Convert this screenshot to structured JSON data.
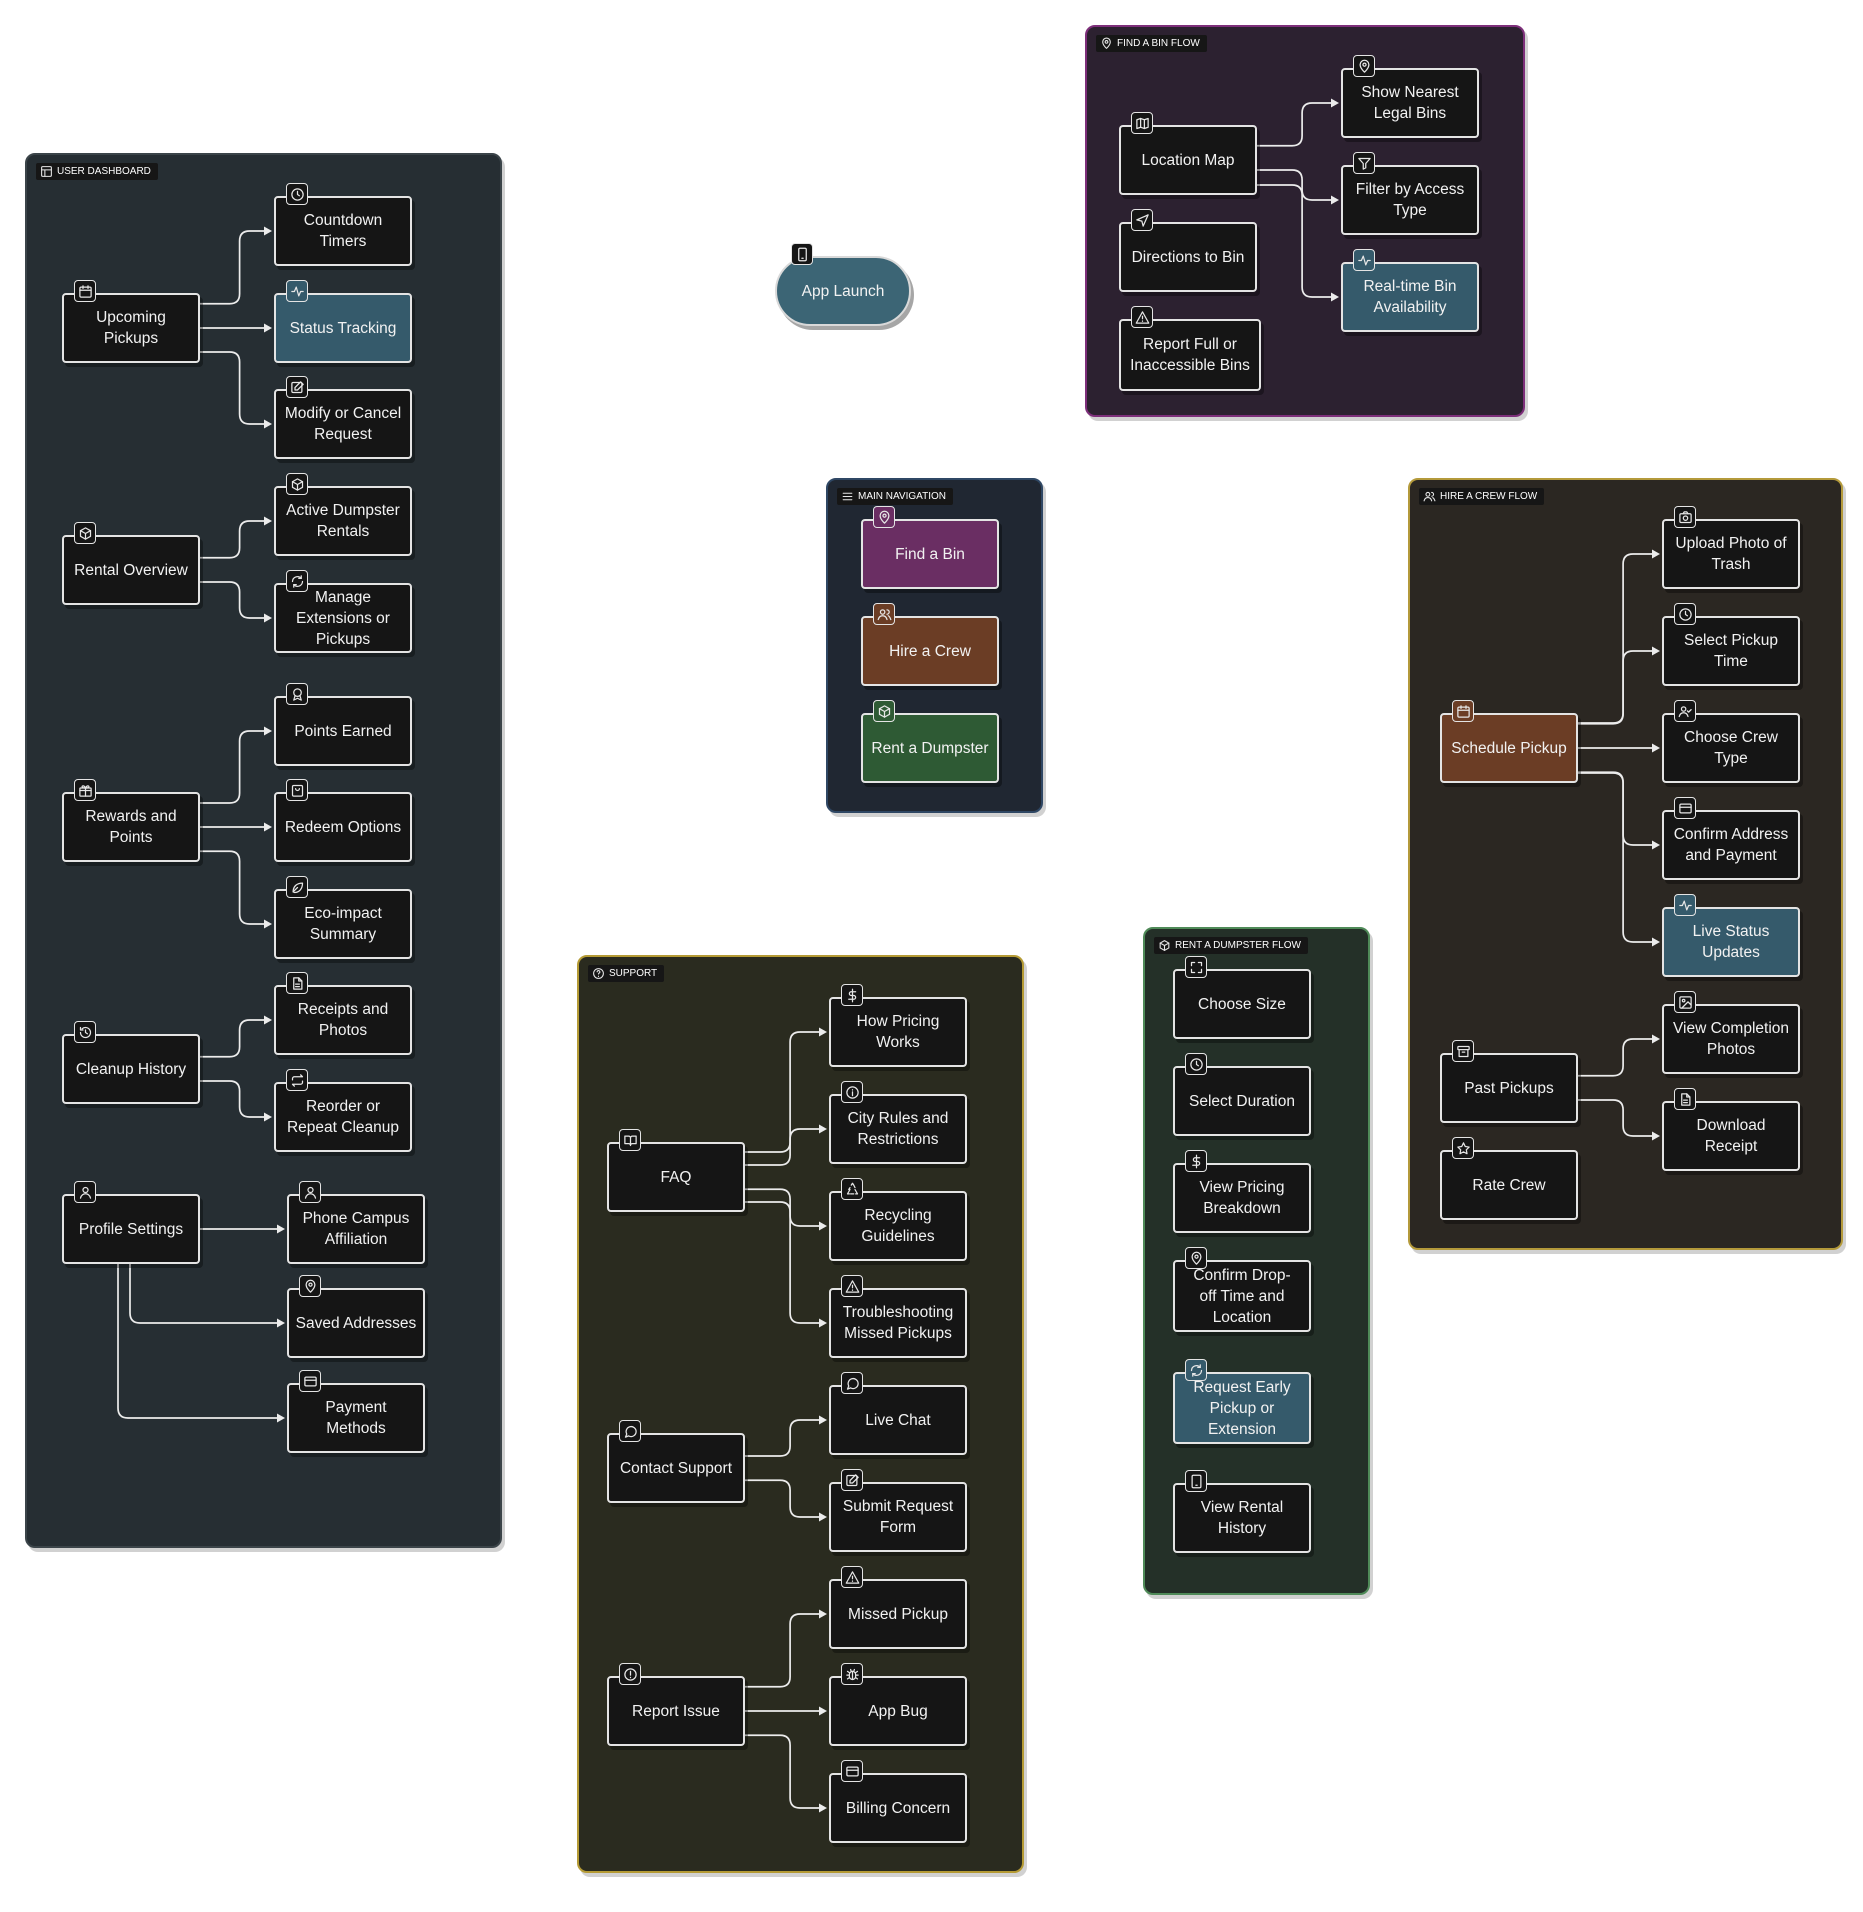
{
  "colors": {
    "node_default": "#151515",
    "node_border": "#e4e4e4",
    "highlight_teal": "#355a6b",
    "find_a_bin_purple": "#6a2e63",
    "hire_a_crew_brown": "#6b3d25",
    "rent_dumpster_green": "#2e5a34",
    "app_launch_teal": "#3c6575"
  },
  "app_launch": {
    "label": "App Launch",
    "icon": "phone-icon"
  },
  "groups": [
    {
      "id": "user-dashboard",
      "title": "USER DASHBOARD",
      "icon": "layout-icon",
      "fill": "#262e33",
      "border": "#3b4449"
    },
    {
      "id": "find-a-bin-flow",
      "title": "FIND A BIN FLOW",
      "icon": "map-pin-icon",
      "fill": "#2c2130",
      "border": "#7d2f7a"
    },
    {
      "id": "main-navigation",
      "title": "MAIN NAVIGATION",
      "icon": "menu-icon",
      "fill": "#202732",
      "border": "#2f4764"
    },
    {
      "id": "hire-a-crew-flow",
      "title": "HIRE A CREW FLOW",
      "icon": "users-icon",
      "fill": "#2b2722",
      "border": "#b49a3b"
    },
    {
      "id": "support",
      "title": "SUPPORT",
      "icon": "help-circle-icon",
      "fill": "#2a2b1f",
      "border": "#b59b35"
    },
    {
      "id": "rent-a-dumpster-flow",
      "title": "RENT A DUMPSTER FLOW",
      "icon": "box-icon",
      "fill": "#243028",
      "border": "#4f8a58"
    }
  ],
  "nodes": [
    {
      "id": "upcoming-pickups",
      "label": "Upcoming\nPickups",
      "icon": "calendar-icon"
    },
    {
      "id": "countdown-timers",
      "label": "Countdown\nTimers",
      "icon": "clock-icon"
    },
    {
      "id": "status-tracking",
      "label": "Status Tracking",
      "icon": "activity-icon",
      "fill": "highlight_teal"
    },
    {
      "id": "modify-cancel",
      "label": "Modify or Cancel\nRequest",
      "icon": "edit-icon"
    },
    {
      "id": "rental-overview",
      "label": "Rental Overview",
      "icon": "box-icon"
    },
    {
      "id": "active-dumpster-rentals",
      "label": "Active Dumpster\nRentals",
      "icon": "box-icon"
    },
    {
      "id": "manage-extensions",
      "label": "Manage\nExtensions or\nPickups",
      "icon": "refresh-icon"
    },
    {
      "id": "rewards-points",
      "label": "Rewards and\nPoints",
      "icon": "gift-icon"
    },
    {
      "id": "points-earned",
      "label": "Points Earned",
      "icon": "award-icon"
    },
    {
      "id": "redeem-options",
      "label": "Redeem Options",
      "icon": "shopping-bag-icon"
    },
    {
      "id": "eco-impact",
      "label": "Eco-impact\nSummary",
      "icon": "leaf-icon"
    },
    {
      "id": "cleanup-history",
      "label": "Cleanup History",
      "icon": "history-icon"
    },
    {
      "id": "receipts-photos",
      "label": "Receipts and\nPhotos",
      "icon": "file-text-icon"
    },
    {
      "id": "reorder-repeat",
      "label": "Reorder or\nRepeat Cleanup",
      "icon": "repeat-icon"
    },
    {
      "id": "profile-settings",
      "label": "Profile Settings",
      "icon": "user-icon"
    },
    {
      "id": "phone-campus",
      "label": "Phone Campus\nAffiliation",
      "icon": "user-icon"
    },
    {
      "id": "saved-addresses",
      "label": "Saved Addresses",
      "icon": "map-pin-icon"
    },
    {
      "id": "payment-methods",
      "label": "Payment\nMethods",
      "icon": "credit-card-icon"
    },
    {
      "id": "location-map",
      "label": "Location Map",
      "icon": "map-icon"
    },
    {
      "id": "show-nearest",
      "label": "Show Nearest\nLegal Bins",
      "icon": "map-pin-icon"
    },
    {
      "id": "filter-access",
      "label": "Filter by Access\nType",
      "icon": "filter-icon"
    },
    {
      "id": "directions-bin",
      "label": "Directions to Bin",
      "icon": "navigation-icon"
    },
    {
      "id": "realtime-availability",
      "label": "Real-time Bin\nAvailability",
      "icon": "activity-icon",
      "fill": "highlight_teal"
    },
    {
      "id": "report-full",
      "label": "Report Full or\nInaccessible Bins",
      "icon": "alert-triangle-icon"
    },
    {
      "id": "nav-find-bin",
      "label": "Find a Bin",
      "icon": "map-pin-icon",
      "fill": "find_a_bin_purple"
    },
    {
      "id": "nav-hire-crew",
      "label": "Hire a Crew",
      "icon": "users-icon",
      "fill": "hire_a_crew_brown"
    },
    {
      "id": "nav-rent-dumpster",
      "label": "Rent a Dumpster",
      "icon": "box-icon",
      "fill": "rent_dumpster_green"
    },
    {
      "id": "schedule-pickup",
      "label": "Schedule Pickup",
      "icon": "calendar-icon",
      "fill": "hire_a_crew_brown"
    },
    {
      "id": "upload-photo",
      "label": "Upload Photo of\nTrash",
      "icon": "camera-icon"
    },
    {
      "id": "select-pickup-time",
      "label": "Select Pickup\nTime",
      "icon": "clock-icon"
    },
    {
      "id": "choose-crew-type",
      "label": "Choose Crew\nType",
      "icon": "user-check-icon"
    },
    {
      "id": "confirm-address-payment",
      "label": "Confirm Address\nand Payment",
      "icon": "credit-card-icon"
    },
    {
      "id": "live-status",
      "label": "Live Status\nUpdates",
      "icon": "activity-icon",
      "fill": "highlight_teal"
    },
    {
      "id": "past-pickups",
      "label": "Past Pickups",
      "icon": "archive-icon"
    },
    {
      "id": "view-completion",
      "label": "View Completion\nPhotos",
      "icon": "image-icon"
    },
    {
      "id": "download-receipt",
      "label": "Download\nReceipt",
      "icon": "file-text-icon"
    },
    {
      "id": "rate-crew",
      "label": "Rate Crew",
      "icon": "star-icon"
    },
    {
      "id": "faq",
      "label": "FAQ",
      "icon": "book-open-icon"
    },
    {
      "id": "how-pricing",
      "label": "How Pricing\nWorks",
      "icon": "dollar-icon"
    },
    {
      "id": "city-rules",
      "label": "City Rules and\nRestrictions",
      "icon": "info-icon"
    },
    {
      "id": "recycling-guidelines",
      "label": "Recycling\nGuidelines",
      "icon": "recycle-icon"
    },
    {
      "id": "troubleshooting",
      "label": "Troubleshooting\nMissed Pickups",
      "icon": "alert-triangle-icon"
    },
    {
      "id": "contact-support",
      "label": "Contact Support",
      "icon": "message-circle-icon"
    },
    {
      "id": "live-chat",
      "label": "Live Chat",
      "icon": "message-circle-icon"
    },
    {
      "id": "submit-request",
      "label": "Submit Request\nForm",
      "icon": "edit-icon"
    },
    {
      "id": "report-issue",
      "label": "Report Issue",
      "icon": "alert-circle-icon"
    },
    {
      "id": "missed-pickup",
      "label": "Missed Pickup",
      "icon": "alert-triangle-icon"
    },
    {
      "id": "app-bug",
      "label": "App Bug",
      "icon": "bug-icon"
    },
    {
      "id": "billing-concern",
      "label": "Billing Concern",
      "icon": "credit-card-icon"
    },
    {
      "id": "choose-size",
      "label": "Choose Size",
      "icon": "maximize-icon"
    },
    {
      "id": "select-duration",
      "label": "Select Duration",
      "icon": "clock-icon"
    },
    {
      "id": "view-pricing",
      "label": "View Pricing\nBreakdown",
      "icon": "dollar-icon"
    },
    {
      "id": "confirm-dropoff",
      "label": "Confirm Drop-\noff Time and\nLocation",
      "icon": "map-pin-icon"
    },
    {
      "id": "request-early",
      "label": "Request Early\nPickup or\nExtension",
      "icon": "refresh-icon",
      "fill": "highlight_teal"
    },
    {
      "id": "view-rental-history",
      "label": "View Rental\nHistory",
      "icon": "tablet-icon"
    }
  ]
}
